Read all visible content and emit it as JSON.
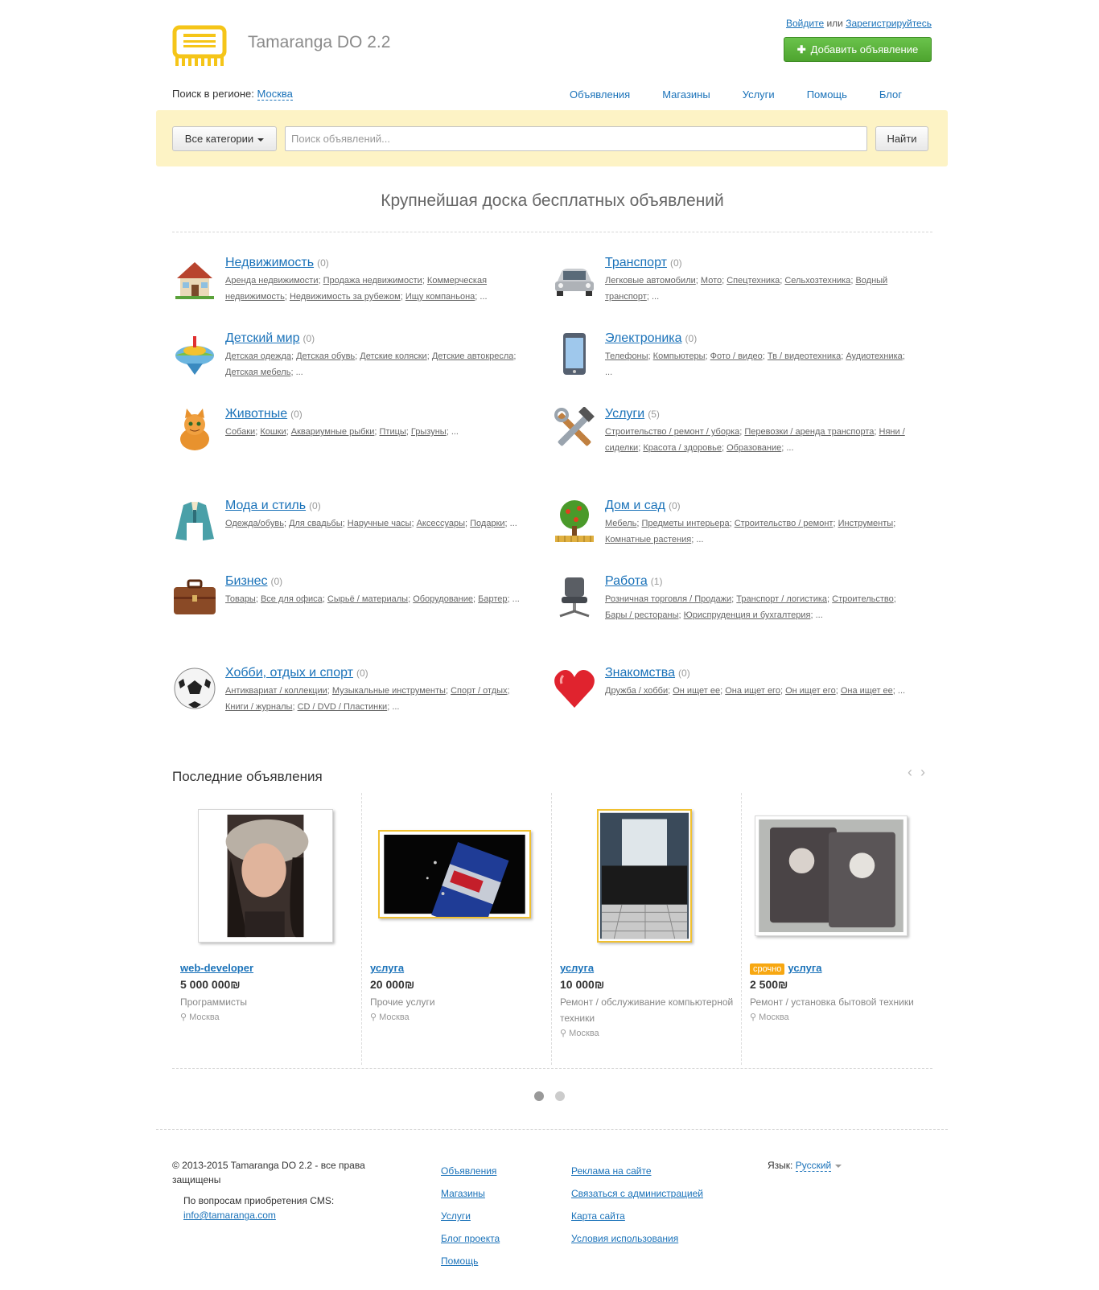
{
  "header": {
    "brand": "Tamaranga DO 2.2",
    "login": "Войдите",
    "or": "или",
    "register": "Зарегистрируйтесь",
    "add_button": "Добавить объявление",
    "add_button_color": "#5cb33c"
  },
  "region": {
    "label": "Поиск в регионе:",
    "city": "Москва"
  },
  "nav": [
    "Объявления",
    "Магазины",
    "Услуги",
    "Помощь",
    "Блог"
  ],
  "search": {
    "category_button": "Все категории",
    "placeholder": "Поиск объявлений...",
    "find_button": "Найти",
    "bar_color": "#fdf3c5"
  },
  "headline": "Крупнейшая доска бесплатных объявлений",
  "categories": [
    {
      "title": "Недвижимость",
      "count": "(0)",
      "icon": "house-icon",
      "subs": [
        "Аренда недвижимости",
        "Продажа недвижимости",
        "Коммерческая недвижимость",
        "Недвижимость за рубежом",
        "Ищу компаньона"
      ]
    },
    {
      "title": "Транспорт",
      "count": "(0)",
      "icon": "car-icon",
      "subs": [
        "Легковые автомобили",
        "Мото",
        "Спецтехника",
        "Сельхозтехника",
        "Водный транспорт"
      ]
    },
    {
      "title": "Детский мир",
      "count": "(0)",
      "icon": "spinning-top-icon",
      "subs": [
        "Детская одежда",
        "Детская обувь",
        "Детские коляски",
        "Детские автокресла",
        "Детская мебель"
      ]
    },
    {
      "title": "Электроника",
      "count": "(0)",
      "icon": "phone-icon",
      "subs": [
        "Телефоны",
        "Компьютеры",
        "Фото / видео",
        "Тв / видеотехника",
        "Аудиотехника"
      ]
    },
    {
      "title": "Животные",
      "count": "(0)",
      "icon": "cat-icon",
      "subs": [
        "Собаки",
        "Кошки",
        "Аквариумные рыбки",
        "Птицы",
        "Грызуны"
      ]
    },
    {
      "title": "Услуги",
      "count": "(5)",
      "icon": "tools-icon",
      "subs": [
        "Строительство / ремонт / уборка",
        "Перевозки / аренда транспорта",
        "Няни / сиделки",
        "Красота / здоровье",
        "Образование"
      ]
    },
    {
      "title": "Мода и стиль",
      "count": "(0)",
      "icon": "jacket-icon",
      "subs": [
        "Одежда/обувь",
        "Для свадьбы",
        "Наручные часы",
        "Аксессуары",
        "Подарки"
      ]
    },
    {
      "title": "Дом и сад",
      "count": "(0)",
      "icon": "tree-icon",
      "subs": [
        "Мебель",
        "Предметы интерьера",
        "Строительство / ремонт",
        "Инструменты",
        "Комнатные растения"
      ]
    },
    {
      "title": "Бизнес",
      "count": "(0)",
      "icon": "briefcase-icon",
      "subs": [
        "Товары",
        "Все для офиса",
        "Сырьё / материалы",
        "Оборудование",
        "Бартер"
      ]
    },
    {
      "title": "Работа",
      "count": "(1)",
      "icon": "office-chair-icon",
      "subs": [
        "Розничная торговля / Продажи",
        "Транспорт / логистика",
        "Строительство",
        "Бары / рестораны",
        "Юриспруденция и бухгалтерия"
      ]
    },
    {
      "title": "Хобби, отдых и спорт",
      "count": "(0)",
      "icon": "soccer-ball-icon",
      "subs": [
        "Антиквариат / коллекции",
        "Музыкальные инструменты",
        "Спорт / отдых",
        "Книги / журналы",
        "CD / DVD / Пластинки"
      ]
    },
    {
      "title": "Знакомства",
      "count": "(0)",
      "icon": "heart-icon",
      "subs": [
        "Дружба / хобби",
        "Он ищет ее",
        "Она ищет его",
        "Он ищет его",
        "Она ищет ее"
      ]
    }
  ],
  "more": "...",
  "latest": {
    "title": "Последние объявления",
    "items": [
      {
        "title": "web-developer",
        "price": "5 000 000₪",
        "category": "Программисты",
        "location": "Москва",
        "badge": ""
      },
      {
        "title": "услуга",
        "price": "20 000₪",
        "category": "Прочие услуги",
        "location": "Москва",
        "badge": ""
      },
      {
        "title": "услуга",
        "price": "10 000₪",
        "category": "Ремонт / обслуживание компьютерной техники",
        "location": "Москва",
        "badge": ""
      },
      {
        "title": "услуга",
        "price": "2 500₪",
        "category": "Ремонт / установка бытовой техники",
        "location": "Москва",
        "badge": "срочно"
      }
    ]
  },
  "footer": {
    "copyright": "© 2013-2015 Tamaranga DO 2.2 - все права защищены",
    "contact_label": "По вопросам приобретения CMS:",
    "contact_email": "info@tamaranga.com",
    "col1": [
      "Объявления",
      "Магазины",
      "Услуги",
      "Блог проекта",
      "Помощь"
    ],
    "col2": [
      "Реклама на сайте",
      "Связаться с администрацией",
      "Карта сайта",
      "Условия использования"
    ],
    "lang_label": "Язык:",
    "lang_value": "Русский"
  }
}
